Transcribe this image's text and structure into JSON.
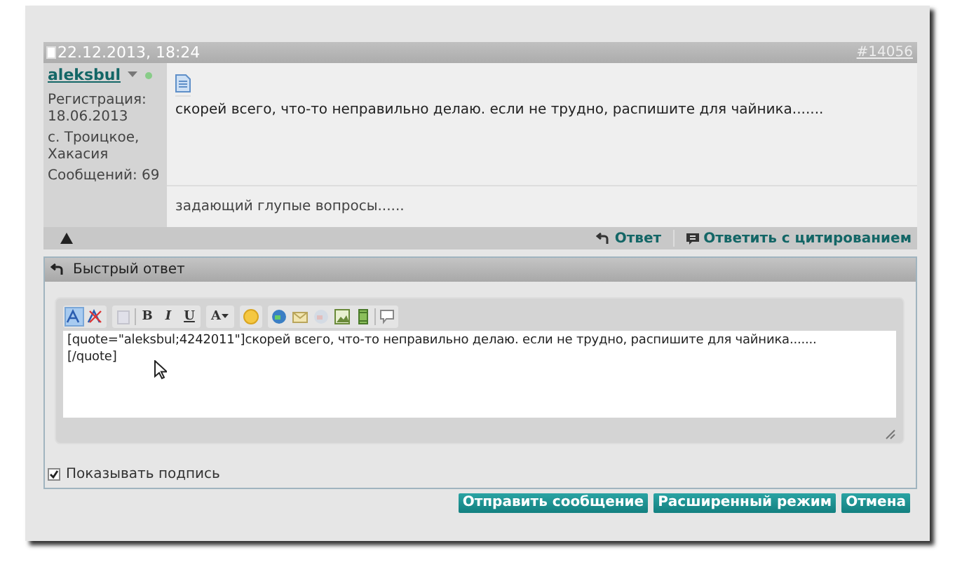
{
  "post": {
    "date": "22.12.2013, 18:24",
    "number": "#14056",
    "author": {
      "name": "aleksbul",
      "online": true,
      "details": [
        "Регистрация:",
        "18.06.2013",
        "с. Троицкое,",
        "Хакасия",
        "Сообщений:  69"
      ]
    },
    "message": "скорей всего, что-то неправильно делаю. если не трудно, распишите для чайника.......",
    "signature": "задающий глупые вопросы......",
    "actions": [
      {
        "label": "Ответ",
        "kind": "reply"
      },
      {
        "label": "Ответить с цитированием",
        "kind": "quote"
      }
    ]
  },
  "quick_reply": {
    "title": "Быстрый ответ",
    "toolbar": {
      "source_mode_active": true,
      "letters": [
        "B",
        "I",
        "U",
        "A"
      ]
    },
    "value": "[quote=\"aleksbul;4242011\"]скорей всего, что-то неправильно делаю. если не трудно, распишите для чайника.......\n[/quote]",
    "show_signature": {
      "label": "Показывать подпись",
      "checked": true
    }
  },
  "buttons": [
    "Отправить сообщение",
    "Расширенный режим",
    "Отмена"
  ]
}
